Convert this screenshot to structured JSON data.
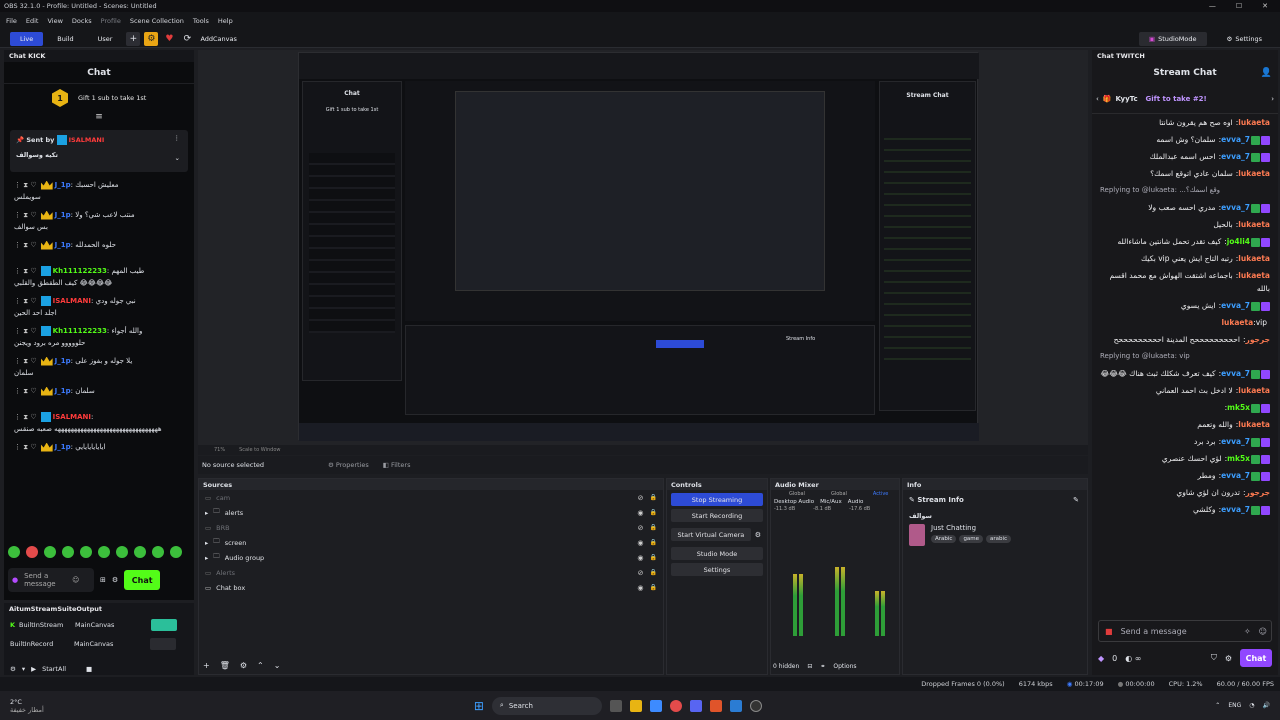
{
  "window": {
    "title": "OBS 32.1.0 - Profile: Untitled - Scenes: Untitled"
  },
  "menu": [
    "File",
    "Edit",
    "View",
    "Docks",
    "Profile",
    "Scene Collection",
    "Tools",
    "Help"
  ],
  "toolbar": {
    "live": "Live",
    "build": "Build",
    "user": "User",
    "add_canvas": "AddCanvas",
    "studio_mode": "StudioMode",
    "settings": "Settings"
  },
  "kick": {
    "dock_title": "Chat KICK",
    "header": "Chat",
    "gift_count": "1",
    "gift_text": "Gift 1 sub to take 1st",
    "pinned_by": "Sent by",
    "pinned_user": "ISALMANI",
    "pinned_text": "تكيه وسوالف",
    "messages": [
      {
        "user": "J_1p",
        "color": "#3d7bff",
        "text": "معليش احسبك",
        "cont": "سويملس"
      },
      {
        "user": "J_1p",
        "color": "#3d7bff",
        "text": "منتب لاعب شي؟ ولا",
        "cont": "بس سوالف"
      },
      {
        "user": "J_1p",
        "color": "#3d7bff",
        "text": "حلوه الحمدلله"
      },
      {
        "user": "Kh111122233",
        "color": "#53fc18",
        "text": "طيب المهم",
        "cont": "كيف الطقطق والقلبي 😂😂😂😂"
      },
      {
        "user": "ISALMANI",
        "color": "#ff3b3b",
        "text": "نبي جوله ودي",
        "cont": "اجلد احد الحين"
      },
      {
        "user": "Kh111122233",
        "color": "#53fc18",
        "text": "والله أجواء",
        "cont": "حلووووو مره برود ويجنن"
      },
      {
        "user": "J_1p",
        "color": "#3d7bff",
        "text": "يلا جوله و بفوز على",
        "cont": "سلمان"
      },
      {
        "user": "J_1p",
        "color": "#3d7bff",
        "text": "سلمان"
      },
      {
        "user": "ISALMANI",
        "color": "#ff3b3b",
        "text": "",
        "cont": "ههههههههههههههههههههههههههههههههه صعبه صنقس"
      },
      {
        "user": "J_1p",
        "color": "#3d7bff",
        "text": "ايايايايايايي"
      }
    ],
    "input_placeholder": "Send a message",
    "chat_button": "Chat"
  },
  "output": {
    "title": "AitumStreamSuiteOutput",
    "rows": [
      {
        "name": "BuiltInStream",
        "canvas": "MainCanvas"
      },
      {
        "name": "BuiltInRecord",
        "canvas": "MainCanvas"
      }
    ],
    "start_all": "StartAll"
  },
  "preview": {
    "zoom": "71%",
    "scale": "Scale to Window",
    "inner": {
      "chat_title": "Chat",
      "stream_chat": "Stream Chat",
      "gift": "Gift 1 sub to take 1st",
      "stream_info": "Stream Info"
    }
  },
  "source_bar": {
    "selected": "No source selected",
    "properties": "Properties",
    "filters": "Filters"
  },
  "sources": {
    "title": "Sources",
    "items": [
      {
        "name": "cam",
        "folder": false,
        "dim": true
      },
      {
        "name": "alerts",
        "folder": true,
        "dim": false
      },
      {
        "name": "BRB",
        "folder": false,
        "dim": true
      },
      {
        "name": "screen",
        "folder": true,
        "dim": false
      },
      {
        "name": "Audio group",
        "folder": true,
        "dim": false
      },
      {
        "name": "Alerts",
        "folder": false,
        "dim": true
      },
      {
        "name": "Chat box",
        "folder": false,
        "dim": false
      }
    ]
  },
  "controls": {
    "title": "Controls",
    "stop_streaming": "Stop Streaming",
    "start_recording": "Start Recording",
    "start_virtual_camera": "Start Virtual Camera",
    "studio_mode": "Studio Mode",
    "settings": "Settings"
  },
  "audio": {
    "title": "Audio Mixer",
    "tabs": [
      "Global",
      "Global",
      "Active"
    ],
    "channels": [
      {
        "name": "Desktop Audio",
        "db": "-11.3 dB",
        "level": 0.55
      },
      {
        "name": "Mic/Aux",
        "db": "-8.1 dB",
        "level": 0.62
      },
      {
        "name": "Audio",
        "db": "-17.6 dB",
        "level": 0.4
      }
    ],
    "hidden": "0 hidden",
    "options": "Options"
  },
  "info": {
    "title": "Info",
    "stream_info": "Stream Info",
    "caption": "سوالف",
    "category": "Just Chatting",
    "tags": [
      "Arabic",
      "game",
      "arabic"
    ]
  },
  "twitch": {
    "dock_title": "Chat TWITCH",
    "header": "Stream Chat",
    "gifter": "KyyTc",
    "gift_count": "1",
    "gift_text": "Gift to take #2!",
    "messages": [
      {
        "user": "lukaeta",
        "cls": "u",
        "text": "اوه صح هم يقرون شانتا"
      },
      {
        "user": "evva_7",
        "cls": "g",
        "text": "سلمان؟ وش اسمه"
      },
      {
        "user": "evva_7",
        "cls": "g",
        "text": "احس اسمه عبدالملك"
      },
      {
        "user": "lukaeta",
        "cls": "u",
        "text": "سلمان عادي اتوقع اسمك؟"
      },
      {
        "user": "evva_7",
        "cls": "g",
        "text": "مدري احسه صعب ولا",
        "reply": "Replying to @lukaeta: ...وقع اسمك؟"
      },
      {
        "user": "lukaeta",
        "cls": "u",
        "text": "بالحيل"
      },
      {
        "user": "jo4li4",
        "cls": "gr",
        "text": "كيف تقدر تحمل شانتين ماشاءالله"
      },
      {
        "user": "lukaeta",
        "cls": "u",
        "text": "رتبه التاج ايش يعني vip بكيك"
      },
      {
        "user": "lukaeta",
        "cls": "u",
        "text": "باجماعه اشتقت الهواش مع محمد اقسم بالله"
      },
      {
        "user": "evva_7",
        "cls": "g",
        "text": "ايش يسوي"
      },
      {
        "user": "lukaeta",
        "cls": "u",
        "text": "vip"
      },
      {
        "user": "جرجور",
        "cls": "u",
        "text": "احححححححححح المدينة احححححححححح"
      },
      {
        "user": "evva_7",
        "cls": "g",
        "text": "كيف تعرف شكلك ثبث هناك 😂😂😂",
        "reply": "Replying to @lukaeta: vip"
      },
      {
        "user": "lukaeta",
        "cls": "u",
        "text": "لا ادخل بث احمد العماني"
      },
      {
        "user": "mk5x",
        "cls": "gr",
        "text": ""
      },
      {
        "user": "lukaeta",
        "cls": "u",
        "text": "والله وتعمم"
      },
      {
        "user": "evva_7",
        "cls": "g",
        "text": "برد برد"
      },
      {
        "user": "mk5x",
        "cls": "gr",
        "text": "لؤي احسك عنصري"
      },
      {
        "user": "evva_7",
        "cls": "g",
        "text": "ومطر"
      },
      {
        "user": "جرجور",
        "cls": "u",
        "text": "تدرون ان لؤي شاوي"
      },
      {
        "user": "evva_7",
        "cls": "g",
        "text": "وكلشي"
      }
    ],
    "input_placeholder": "Send a message",
    "points": "0",
    "chat_button": "Chat"
  },
  "status": {
    "dropped": "Dropped Frames 0 (0.0%)",
    "kbps": "6174 kbps",
    "stream_time": "00:17:09",
    "rec_time": "00:00:00",
    "cpu": "CPU: 1.2%",
    "fps": "60.00 / 60.00 FPS"
  },
  "taskbar": {
    "weather": "2°C",
    "weather_note": "أمطار خفيفة",
    "search": "Search",
    "lang": "ENG"
  }
}
